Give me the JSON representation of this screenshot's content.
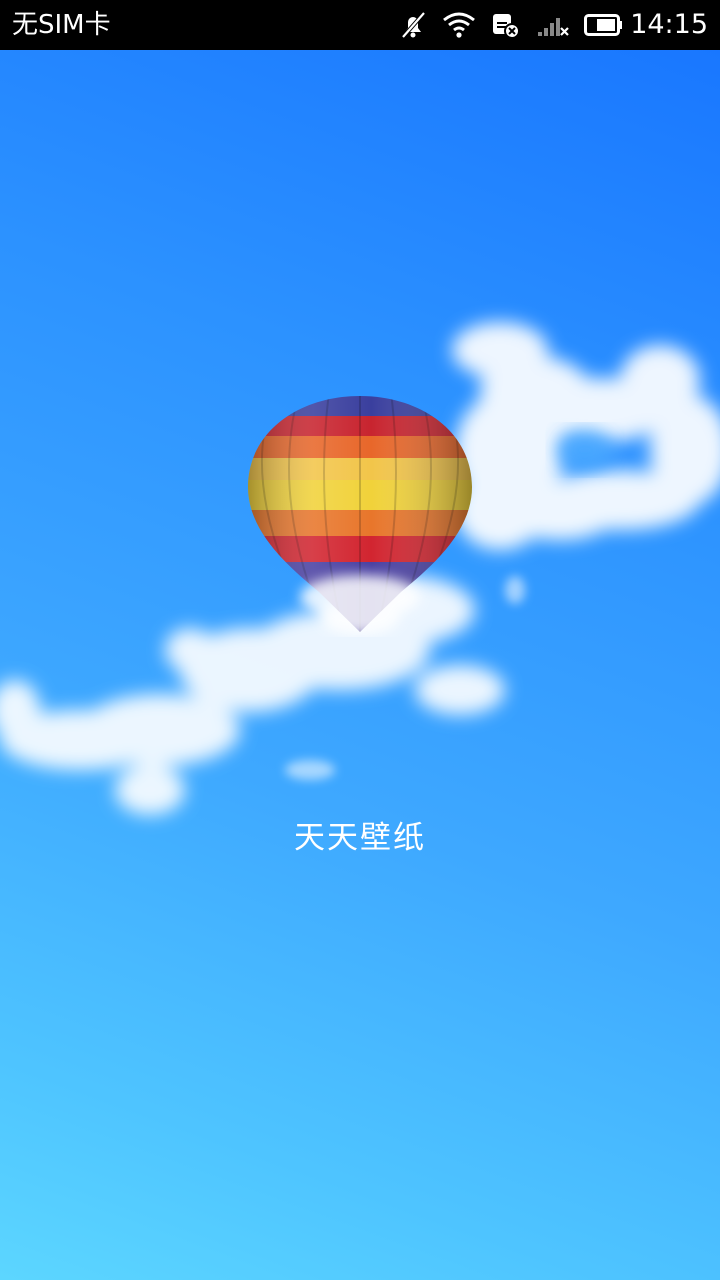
{
  "status_bar": {
    "carrier": "无SIM卡",
    "time": "14:15",
    "icons": [
      "mute-icon",
      "wifi-icon",
      "sim-error-icon",
      "signal-icon",
      "battery-icon"
    ]
  },
  "splash": {
    "app_name": "天天壁纸"
  },
  "colors": {
    "sky_top": "#1977ff",
    "sky_bottom": "#5cd6ff",
    "status_bar": "#000000"
  }
}
